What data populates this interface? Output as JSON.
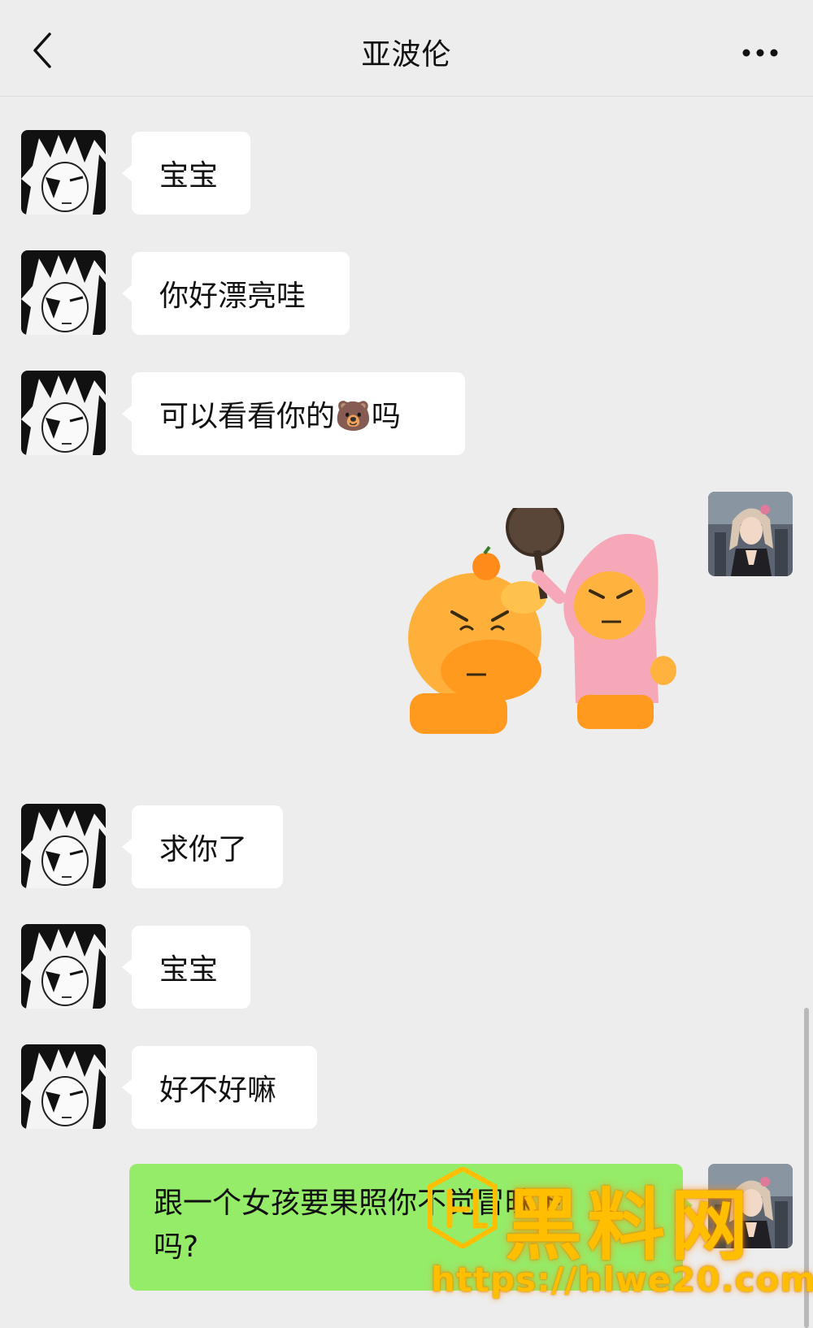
{
  "header": {
    "title": "亚波伦"
  },
  "messages": [
    {
      "side": "left",
      "type": "text",
      "text": "宝宝"
    },
    {
      "side": "left",
      "type": "text",
      "text": "你好漂亮哇"
    },
    {
      "side": "left",
      "type": "text",
      "text": "可以看看你的🐻吗"
    },
    {
      "side": "right",
      "type": "sticker",
      "icon": "capybara-frying-pan-sticker"
    },
    {
      "side": "left",
      "type": "text",
      "text": "求你了"
    },
    {
      "side": "left",
      "type": "text",
      "text": "宝宝"
    },
    {
      "side": "left",
      "type": "text",
      "text": "好不好嘛"
    },
    {
      "side": "right",
      "type": "text",
      "text": "跟一个女孩要果照你不觉冒昧下吗?"
    }
  ],
  "green_message": {
    "line1": "跟一个女孩要果照你不觉冒昧下",
    "line2": "吗?"
  },
  "watermark": {
    "logo_text": "黑料网",
    "url": "https://hlwe20.com"
  },
  "colors": {
    "background": "#ededed",
    "bubble_left": "#ffffff",
    "bubble_right": "#95ec69",
    "watermark": "#ffbf00"
  },
  "icons": {
    "back": "chevron-left-icon",
    "more": "more-dots-icon"
  }
}
